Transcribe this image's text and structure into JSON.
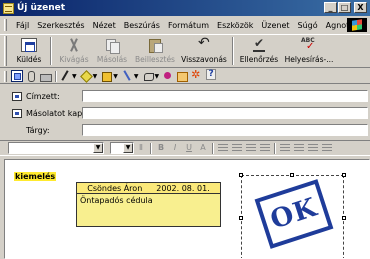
{
  "window": {
    "title": "Új üzenet",
    "min_glyph": "_",
    "max_glyph": "□",
    "close_glyph": "X"
  },
  "menu": [
    {
      "label": "Fájl"
    },
    {
      "label": "Szerkesztés"
    },
    {
      "label": "Nézet"
    },
    {
      "label": "Beszúrás"
    },
    {
      "label": "Formátum"
    },
    {
      "label": "Eszközök"
    },
    {
      "label": "Üzenet"
    },
    {
      "label": "Súgó"
    },
    {
      "label": "Agnotis"
    }
  ],
  "toolbar": [
    {
      "label": "Küldés",
      "icon": "send-icon",
      "enabled": true
    },
    {
      "label": "Kivágás",
      "icon": "cut-icon",
      "enabled": false
    },
    {
      "label": "Másolás",
      "icon": "copy-icon",
      "enabled": false
    },
    {
      "label": "Beillesztés",
      "icon": "paste-icon",
      "enabled": false
    },
    {
      "label": "Visszavonás",
      "icon": "undo-icon",
      "enabled": true
    },
    {
      "label": "Ellenőrzés",
      "icon": "check-names-icon",
      "enabled": true
    },
    {
      "label": "Helyesírás-...",
      "icon": "spelling-icon",
      "enabled": true
    }
  ],
  "headers": {
    "to_label": "Címzett:",
    "cc_label": "Másolatot kap:",
    "subject_label": "Tárgy:"
  },
  "body": {
    "highlighted_word": "kiemelés",
    "note": {
      "author": "Csöndes Áron",
      "date": "2002. 08. 01.",
      "text": "Öntapadós cédula"
    },
    "stamp_text": "OK"
  },
  "colors": {
    "title_bar": "#0a246a",
    "highlight": "#ffea2e",
    "note": "#f8ef8f",
    "stamp": "#1f3c9a"
  }
}
